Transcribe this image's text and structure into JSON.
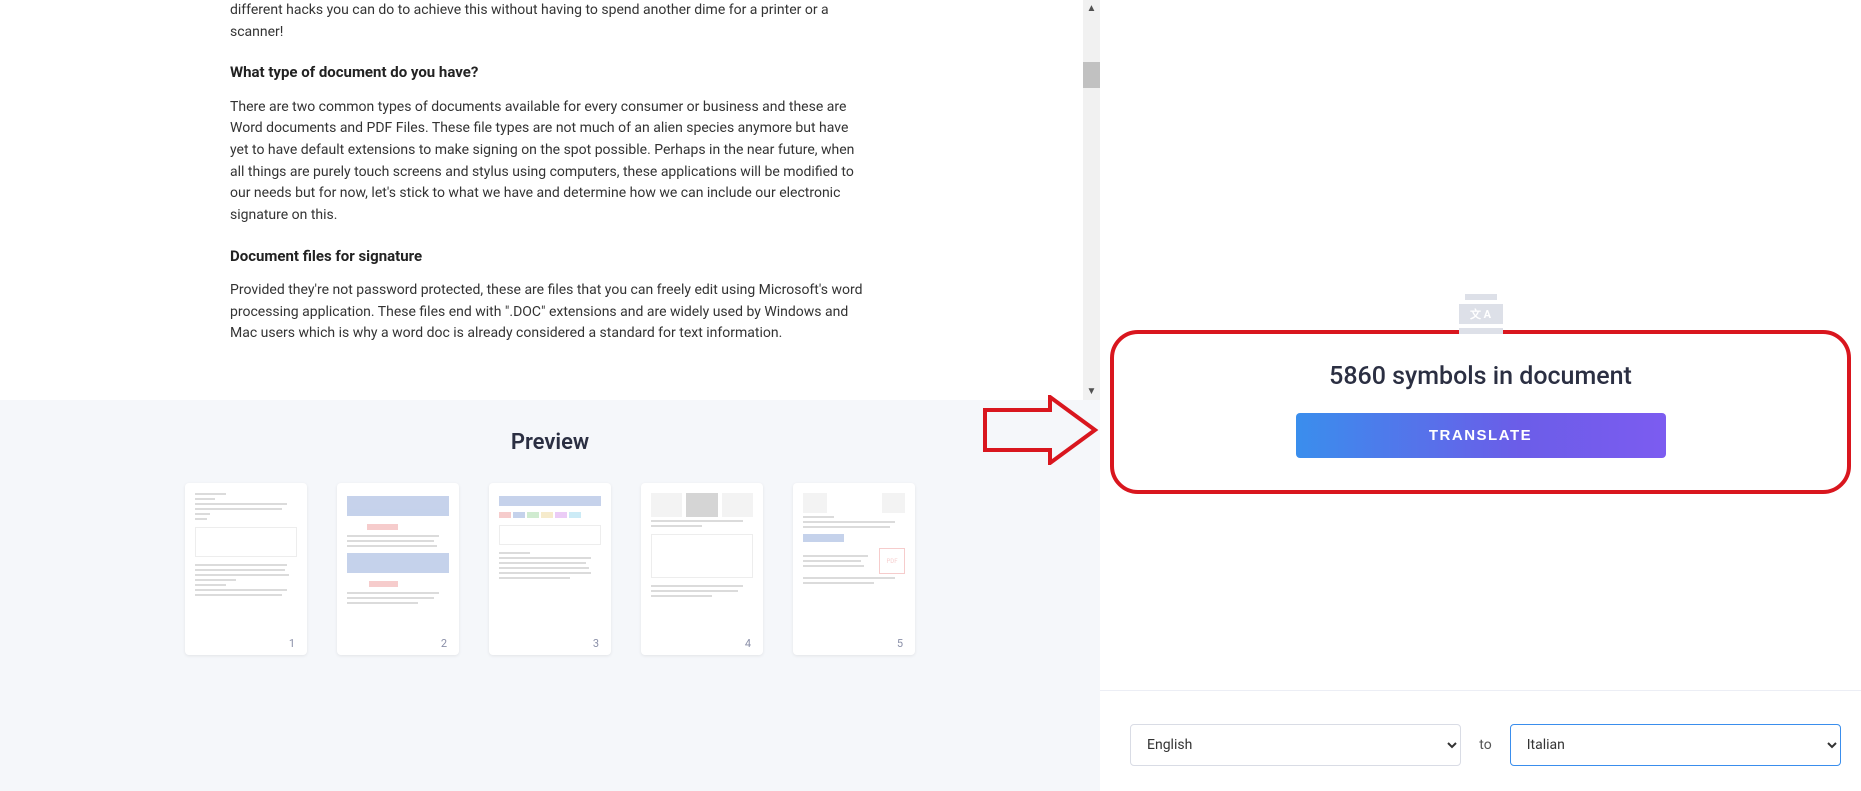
{
  "document": {
    "intro_fragment": "different hacks you can do to achieve this without having to spend another dime for a printer or a scanner!",
    "heading1": "What type of document do you have?",
    "para1": "There are two common types of documents available for every consumer or business and these are Word documents and PDF Files. These file types are not much of an alien species anymore but have yet to have default extensions to make signing on the spot possible. Perhaps in the near future, when all things are purely touch screens and stylus using computers, these applications will be modified to our needs but for now, let's stick to what we have and determine how we can include our electronic signature on this.",
    "heading2": "Document files for signature",
    "para2": "Provided they're not password protected, these are files that you can freely edit using Microsoft's word processing application. These files end with \".DOC\" extensions and are widely used by Windows and Mac users which is why a word doc is already considered a standard for text information."
  },
  "preview": {
    "title": "Preview",
    "pages": [
      {
        "num": "1"
      },
      {
        "num": "2"
      },
      {
        "num": "3"
      },
      {
        "num": "4"
      },
      {
        "num": "5"
      }
    ]
  },
  "translate": {
    "icon_text": "文 A",
    "symbols_text": "5860 symbols in document",
    "button_label": "TRANSLATE"
  },
  "languages": {
    "from": "English",
    "to_label": "to",
    "to": "Italian"
  }
}
